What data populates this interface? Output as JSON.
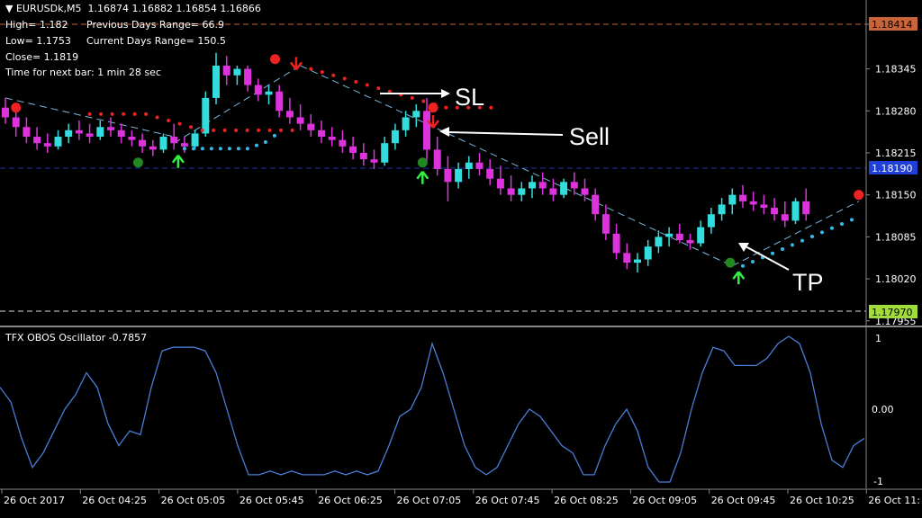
{
  "header": {
    "symbol_line": "EURUSDk,M5  1.16874 1.16882 1.16854 1.16866",
    "high": "High= 1.182",
    "prev_range": "Previous Days Range= 66.9",
    "low": "Low= 1.1753",
    "curr_range": "Current Days Range= 150.5",
    "close": "Close= 1.1819",
    "next_bar": "Time for next bar: 1 min 28 sec"
  },
  "annotations": {
    "sl": "SL",
    "sell": "Sell",
    "tp": "TP"
  },
  "price_badges": {
    "top": "1.18414",
    "mid": "1.18190",
    "bottom": "1.17970"
  },
  "oscillator": {
    "title": "TFX OBOS Oscillator -0.7857",
    "tick_labels": [
      "1",
      "0.00",
      "-1"
    ]
  },
  "colors": {
    "bull": "#33dddd",
    "bear": "#dd33dd",
    "upper_dots": "#ee2222",
    "lower_dots": "#33bbee",
    "osc_line": "#4a7dd6",
    "grid": "#555555",
    "badge_top": "#c8643a",
    "badge_mid": "#1f3fd8",
    "badge_bottom": "#a0dd3a"
  },
  "chart_data": [
    {
      "type": "candlestick",
      "title": "EURUSDk,M5",
      "y_ticks": [
        "1.18414",
        "1.18345",
        "1.18280",
        "1.18215",
        "1.18150",
        "1.18085",
        "1.18020",
        "1.17955"
      ],
      "ylim": [
        1.1795,
        1.1842
      ],
      "x_ticks": [
        "26 Oct 2017",
        "26 Oct 04:25",
        "26 Oct 05:05",
        "26 Oct 05:45",
        "26 Oct 06:25",
        "26 Oct 07:05",
        "26 Oct 07:45",
        "26 Oct 08:25",
        "26 Oct 09:05",
        "26 Oct 09:45",
        "26 Oct 10:25",
        "26 Oct 11:"
      ],
      "ohlc": [
        [
          1.18285,
          1.183,
          1.1826,
          1.1827
        ],
        [
          1.1827,
          1.18285,
          1.1824,
          1.18255
        ],
        [
          1.18255,
          1.1827,
          1.1823,
          1.1824
        ],
        [
          1.1824,
          1.18255,
          1.1822,
          1.1823
        ],
        [
          1.1823,
          1.18245,
          1.18215,
          1.18225
        ],
        [
          1.18225,
          1.1825,
          1.1822,
          1.1824
        ],
        [
          1.1824,
          1.1826,
          1.1823,
          1.1825
        ],
        [
          1.1825,
          1.18265,
          1.18235,
          1.18245
        ],
        [
          1.18245,
          1.1826,
          1.1823,
          1.1824
        ],
        [
          1.1824,
          1.18265,
          1.18235,
          1.18255
        ],
        [
          1.18255,
          1.1827,
          1.1824,
          1.1825
        ],
        [
          1.1825,
          1.1826,
          1.1823,
          1.1824
        ],
        [
          1.1824,
          1.1825,
          1.18225,
          1.18235
        ],
        [
          1.18235,
          1.18245,
          1.18215,
          1.18225
        ],
        [
          1.18225,
          1.18235,
          1.1821,
          1.1822
        ],
        [
          1.1822,
          1.18245,
          1.18215,
          1.1824
        ],
        [
          1.1824,
          1.1826,
          1.1822,
          1.1823
        ],
        [
          1.1823,
          1.1824,
          1.18215,
          1.18225
        ],
        [
          1.18225,
          1.1825,
          1.1822,
          1.18245
        ],
        [
          1.18245,
          1.1831,
          1.1824,
          1.183
        ],
        [
          1.183,
          1.1837,
          1.1829,
          1.1835
        ],
        [
          1.1835,
          1.18365,
          1.1832,
          1.18335
        ],
        [
          1.18335,
          1.1835,
          1.1832,
          1.18345
        ],
        [
          1.18345,
          1.1835,
          1.1831,
          1.1832
        ],
        [
          1.1832,
          1.1833,
          1.18295,
          1.18305
        ],
        [
          1.18305,
          1.1832,
          1.1829,
          1.1831
        ],
        [
          1.1831,
          1.1832,
          1.1827,
          1.1828
        ],
        [
          1.1828,
          1.183,
          1.1826,
          1.1827
        ],
        [
          1.1827,
          1.1829,
          1.1825,
          1.1826
        ],
        [
          1.1826,
          1.18275,
          1.1824,
          1.1825
        ],
        [
          1.1825,
          1.18265,
          1.1823,
          1.1824
        ],
        [
          1.1824,
          1.18255,
          1.18225,
          1.18235
        ],
        [
          1.18235,
          1.1825,
          1.18215,
          1.18225
        ],
        [
          1.18225,
          1.1824,
          1.18205,
          1.18215
        ],
        [
          1.18215,
          1.1823,
          1.18195,
          1.18205
        ],
        [
          1.18205,
          1.1822,
          1.1819,
          1.182
        ],
        [
          1.182,
          1.1824,
          1.18195,
          1.1823
        ],
        [
          1.1823,
          1.1826,
          1.1822,
          1.1825
        ],
        [
          1.1825,
          1.1828,
          1.1824,
          1.1827
        ],
        [
          1.1827,
          1.1829,
          1.18255,
          1.1828
        ],
        [
          1.1828,
          1.183,
          1.182,
          1.1822
        ],
        [
          1.1822,
          1.1824,
          1.1818,
          1.1819
        ],
        [
          1.1819,
          1.1821,
          1.1814,
          1.1817
        ],
        [
          1.1817,
          1.182,
          1.1816,
          1.1819
        ],
        [
          1.1819,
          1.1821,
          1.18175,
          1.182
        ],
        [
          1.182,
          1.18215,
          1.1818,
          1.1819
        ],
        [
          1.1819,
          1.18205,
          1.18165,
          1.18175
        ],
        [
          1.18175,
          1.18195,
          1.1815,
          1.1816
        ],
        [
          1.1816,
          1.1818,
          1.1814,
          1.1815
        ],
        [
          1.1815,
          1.1817,
          1.1814,
          1.1816
        ],
        [
          1.1816,
          1.1818,
          1.18145,
          1.1817
        ],
        [
          1.1817,
          1.18185,
          1.1815,
          1.1816
        ],
        [
          1.1816,
          1.18175,
          1.1814,
          1.1815
        ],
        [
          1.1815,
          1.18175,
          1.18145,
          1.1817
        ],
        [
          1.1817,
          1.18185,
          1.1815,
          1.1816
        ],
        [
          1.1816,
          1.18175,
          1.1814,
          1.1815
        ],
        [
          1.1815,
          1.1816,
          1.1811,
          1.1812
        ],
        [
          1.1812,
          1.18135,
          1.1808,
          1.1809
        ],
        [
          1.1809,
          1.18105,
          1.1805,
          1.1806
        ],
        [
          1.1806,
          1.18075,
          1.18035,
          1.18045
        ],
        [
          1.18045,
          1.1806,
          1.1803,
          1.1805
        ],
        [
          1.1805,
          1.1808,
          1.1804,
          1.1807
        ],
        [
          1.1807,
          1.18095,
          1.1806,
          1.18085
        ],
        [
          1.18085,
          1.181,
          1.1807,
          1.1809
        ],
        [
          1.1809,
          1.18105,
          1.18075,
          1.1808
        ],
        [
          1.1808,
          1.1809,
          1.18065,
          1.18075
        ],
        [
          1.18075,
          1.1811,
          1.1807,
          1.181
        ],
        [
          1.181,
          1.1813,
          1.1809,
          1.1812
        ],
        [
          1.1812,
          1.18145,
          1.1811,
          1.18135
        ],
        [
          1.18135,
          1.1816,
          1.1812,
          1.1815
        ],
        [
          1.1815,
          1.18165,
          1.1813,
          1.1814
        ],
        [
          1.1814,
          1.18155,
          1.18125,
          1.18135
        ],
        [
          1.18135,
          1.1815,
          1.1812,
          1.1813
        ],
        [
          1.1813,
          1.18145,
          1.1811,
          1.1812
        ],
        [
          1.1812,
          1.1814,
          1.181,
          1.1811
        ],
        [
          1.1811,
          1.18145,
          1.18105,
          1.1814
        ],
        [
          1.1814,
          1.1816,
          1.1811,
          1.1812
        ]
      ],
      "upper_stop_dots": [
        [
          1.18275,
          1.18275,
          1.18275,
          1.18275,
          1.18275,
          1.18275,
          1.1827,
          1.18265,
          1.1826,
          1.18255,
          1.1825,
          1.1825,
          1.1825,
          1.1825,
          1.1825,
          1.1825,
          1.1825,
          1.1825,
          1.1825
        ],
        [
          1.18345,
          1.1834,
          1.18335,
          1.1833,
          1.18325,
          1.1832,
          1.18315,
          1.1831,
          1.18305,
          1.183,
          1.18295,
          1.1829,
          1.18285,
          1.18285,
          1.18285,
          1.18285,
          1.18285
        ]
      ],
      "lower_stop_dots": [
        1.1823,
        1.1823,
        1.1823,
        1.1823,
        1.1823,
        1.1823,
        1.1823,
        1.1823,
        1.18235,
        1.1824,
        1.1825
      ],
      "annotated_levels": {
        "top": 1.18414,
        "mid": 1.1819,
        "bottom": 1.1797
      }
    },
    {
      "type": "line",
      "title": "TFX OBOS Oscillator -0.7857",
      "ylim": [
        -1.05,
        1.05
      ],
      "y_ticks": [
        1,
        0.0,
        -1
      ],
      "values": [
        0.3,
        0.1,
        -0.4,
        -0.8,
        -0.6,
        -0.3,
        0.0,
        0.2,
        0.5,
        0.3,
        -0.2,
        -0.5,
        -0.3,
        -0.35,
        0.3,
        0.8,
        0.85,
        0.85,
        0.85,
        0.8,
        0.5,
        0.0,
        -0.5,
        -0.9,
        -0.9,
        -0.85,
        -0.9,
        -0.85,
        -0.9,
        -0.9,
        -0.9,
        -0.85,
        -0.9,
        -0.85,
        -0.9,
        -0.85,
        -0.5,
        -0.1,
        0.0,
        0.3,
        0.9,
        0.5,
        0.0,
        -0.5,
        -0.8,
        -0.9,
        -0.8,
        -0.5,
        -0.2,
        0.0,
        -0.1,
        -0.3,
        -0.5,
        -0.6,
        -0.9,
        -0.9,
        -0.5,
        -0.2,
        0.0,
        -0.3,
        -0.8,
        -1.0,
        -1.0,
        -0.6,
        0.0,
        0.5,
        0.85,
        0.8,
        0.6,
        0.6,
        0.6,
        0.7,
        0.9,
        1.0,
        0.9,
        0.5,
        -0.2,
        -0.7,
        -0.8,
        -0.5,
        -0.4
      ]
    }
  ]
}
